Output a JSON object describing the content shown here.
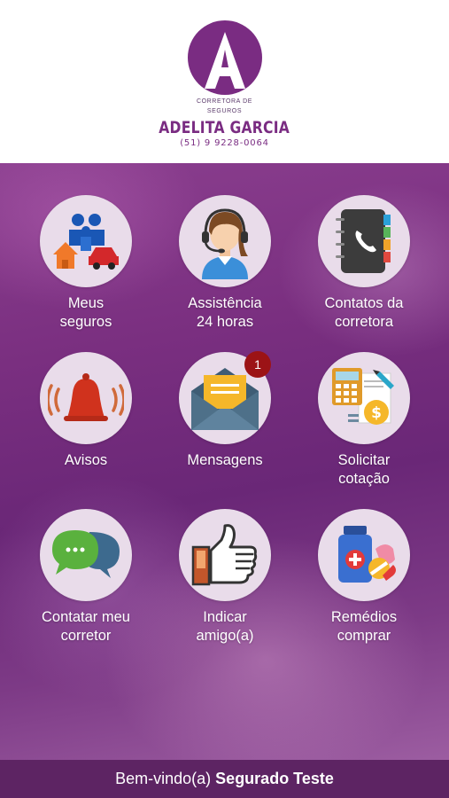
{
  "brand": {
    "logo_letter": "A",
    "tagline_line1": "CORRETORA DE",
    "tagline_line2": "SEGUROS",
    "name": "ADELITA GARCIA",
    "phone": "(51) 9 9228-0064",
    "color": "#7a2c82"
  },
  "menu": {
    "items": [
      {
        "label": "Meus\nseguros",
        "icon": "family-home-car-icon"
      },
      {
        "label": "Assistência\n24 horas",
        "icon": "headset-agent-icon"
      },
      {
        "label": "Contatos da\ncorretora",
        "icon": "phonebook-icon"
      },
      {
        "label": "Avisos",
        "icon": "alarm-bell-icon"
      },
      {
        "label": "Mensagens",
        "icon": "envelope-message-icon",
        "badge": "1"
      },
      {
        "label": "Solicitar\ncotação",
        "icon": "calculator-quote-icon"
      },
      {
        "label": "Contatar meu\ncorretor",
        "icon": "chat-bubbles-icon"
      },
      {
        "label": "Indicar\namigo(a)",
        "icon": "thumbs-up-icon"
      },
      {
        "label": "Remédios\ncomprar",
        "icon": "medicine-icon"
      }
    ]
  },
  "footer": {
    "greeting": "Bem-vindo(a)",
    "user_name": "Segurado Teste"
  },
  "colors": {
    "main_bg": "#7a2f80",
    "footer_bg": "#5d2463",
    "tile_circle": "#e9dcea",
    "badge": "#9c1316"
  }
}
